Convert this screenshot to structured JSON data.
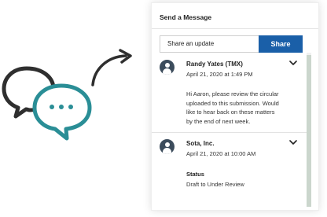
{
  "panel": {
    "title": "Send a Message",
    "share_placeholder": "Share an update",
    "share_button": "Share"
  },
  "messages": [
    {
      "author": "Randy Yates (TMX)",
      "date": "April 21, 2020 at 1:49 PM",
      "body_lines": [
        "Hi Aaron, please review the circular",
        "uploaded to this submission.  Would",
        "like to hear back on these matters",
        "by the end of next week."
      ]
    },
    {
      "author": "Sota, Inc.",
      "date": "April 21, 2020 at 10:00 AM",
      "status_label": "Status",
      "status_value": "Draft to Under Review"
    }
  ],
  "colors": {
    "accent": "#1a5fa8",
    "avatar": "#3c4c5c",
    "bubble_dark": "#333333",
    "bubble_teal": "#2a8e96",
    "scroll_thumb": "#cbd6cd"
  },
  "icons": [
    "chat-bubbles-illustration",
    "curved-arrow-icon",
    "avatar-icon",
    "chevron-down-icon"
  ]
}
